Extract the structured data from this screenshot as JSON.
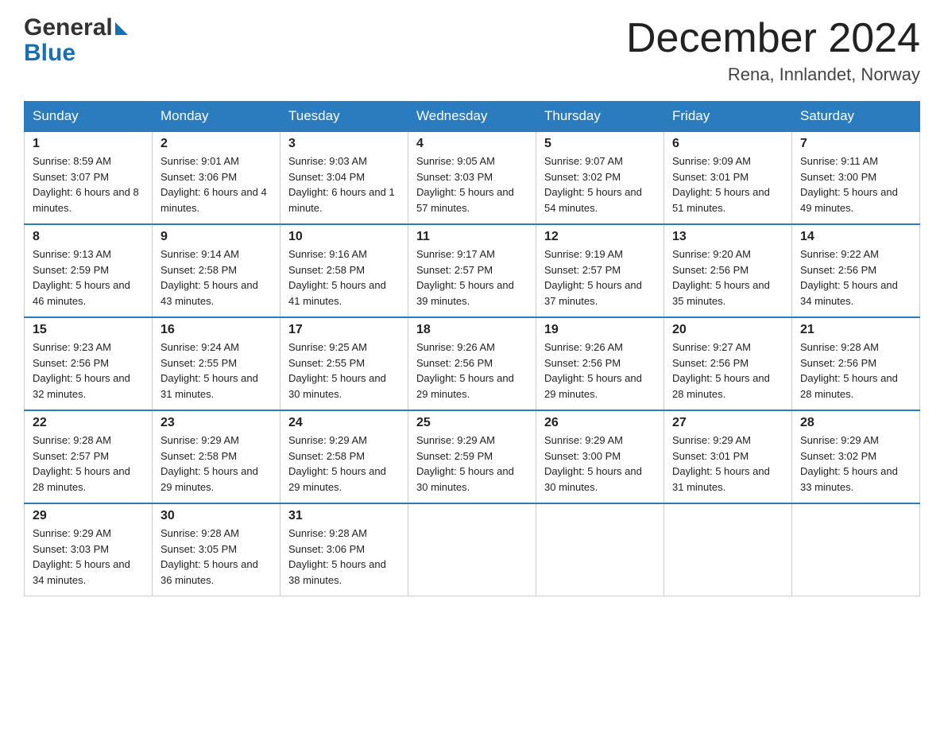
{
  "header": {
    "title": "December 2024",
    "location": "Rena, Innlandet, Norway",
    "logo_general": "General",
    "logo_blue": "Blue"
  },
  "days_of_week": [
    "Sunday",
    "Monday",
    "Tuesday",
    "Wednesday",
    "Thursday",
    "Friday",
    "Saturday"
  ],
  "weeks": [
    [
      {
        "day": "1",
        "sunrise": "Sunrise: 8:59 AM",
        "sunset": "Sunset: 3:07 PM",
        "daylight": "Daylight: 6 hours and 8 minutes."
      },
      {
        "day": "2",
        "sunrise": "Sunrise: 9:01 AM",
        "sunset": "Sunset: 3:06 PM",
        "daylight": "Daylight: 6 hours and 4 minutes."
      },
      {
        "day": "3",
        "sunrise": "Sunrise: 9:03 AM",
        "sunset": "Sunset: 3:04 PM",
        "daylight": "Daylight: 6 hours and 1 minute."
      },
      {
        "day": "4",
        "sunrise": "Sunrise: 9:05 AM",
        "sunset": "Sunset: 3:03 PM",
        "daylight": "Daylight: 5 hours and 57 minutes."
      },
      {
        "day": "5",
        "sunrise": "Sunrise: 9:07 AM",
        "sunset": "Sunset: 3:02 PM",
        "daylight": "Daylight: 5 hours and 54 minutes."
      },
      {
        "day": "6",
        "sunrise": "Sunrise: 9:09 AM",
        "sunset": "Sunset: 3:01 PM",
        "daylight": "Daylight: 5 hours and 51 minutes."
      },
      {
        "day": "7",
        "sunrise": "Sunrise: 9:11 AM",
        "sunset": "Sunset: 3:00 PM",
        "daylight": "Daylight: 5 hours and 49 minutes."
      }
    ],
    [
      {
        "day": "8",
        "sunrise": "Sunrise: 9:13 AM",
        "sunset": "Sunset: 2:59 PM",
        "daylight": "Daylight: 5 hours and 46 minutes."
      },
      {
        "day": "9",
        "sunrise": "Sunrise: 9:14 AM",
        "sunset": "Sunset: 2:58 PM",
        "daylight": "Daylight: 5 hours and 43 minutes."
      },
      {
        "day": "10",
        "sunrise": "Sunrise: 9:16 AM",
        "sunset": "Sunset: 2:58 PM",
        "daylight": "Daylight: 5 hours and 41 minutes."
      },
      {
        "day": "11",
        "sunrise": "Sunrise: 9:17 AM",
        "sunset": "Sunset: 2:57 PM",
        "daylight": "Daylight: 5 hours and 39 minutes."
      },
      {
        "day": "12",
        "sunrise": "Sunrise: 9:19 AM",
        "sunset": "Sunset: 2:57 PM",
        "daylight": "Daylight: 5 hours and 37 minutes."
      },
      {
        "day": "13",
        "sunrise": "Sunrise: 9:20 AM",
        "sunset": "Sunset: 2:56 PM",
        "daylight": "Daylight: 5 hours and 35 minutes."
      },
      {
        "day": "14",
        "sunrise": "Sunrise: 9:22 AM",
        "sunset": "Sunset: 2:56 PM",
        "daylight": "Daylight: 5 hours and 34 minutes."
      }
    ],
    [
      {
        "day": "15",
        "sunrise": "Sunrise: 9:23 AM",
        "sunset": "Sunset: 2:56 PM",
        "daylight": "Daylight: 5 hours and 32 minutes."
      },
      {
        "day": "16",
        "sunrise": "Sunrise: 9:24 AM",
        "sunset": "Sunset: 2:55 PM",
        "daylight": "Daylight: 5 hours and 31 minutes."
      },
      {
        "day": "17",
        "sunrise": "Sunrise: 9:25 AM",
        "sunset": "Sunset: 2:55 PM",
        "daylight": "Daylight: 5 hours and 30 minutes."
      },
      {
        "day": "18",
        "sunrise": "Sunrise: 9:26 AM",
        "sunset": "Sunset: 2:56 PM",
        "daylight": "Daylight: 5 hours and 29 minutes."
      },
      {
        "day": "19",
        "sunrise": "Sunrise: 9:26 AM",
        "sunset": "Sunset: 2:56 PM",
        "daylight": "Daylight: 5 hours and 29 minutes."
      },
      {
        "day": "20",
        "sunrise": "Sunrise: 9:27 AM",
        "sunset": "Sunset: 2:56 PM",
        "daylight": "Daylight: 5 hours and 28 minutes."
      },
      {
        "day": "21",
        "sunrise": "Sunrise: 9:28 AM",
        "sunset": "Sunset: 2:56 PM",
        "daylight": "Daylight: 5 hours and 28 minutes."
      }
    ],
    [
      {
        "day": "22",
        "sunrise": "Sunrise: 9:28 AM",
        "sunset": "Sunset: 2:57 PM",
        "daylight": "Daylight: 5 hours and 28 minutes."
      },
      {
        "day": "23",
        "sunrise": "Sunrise: 9:29 AM",
        "sunset": "Sunset: 2:58 PM",
        "daylight": "Daylight: 5 hours and 29 minutes."
      },
      {
        "day": "24",
        "sunrise": "Sunrise: 9:29 AM",
        "sunset": "Sunset: 2:58 PM",
        "daylight": "Daylight: 5 hours and 29 minutes."
      },
      {
        "day": "25",
        "sunrise": "Sunrise: 9:29 AM",
        "sunset": "Sunset: 2:59 PM",
        "daylight": "Daylight: 5 hours and 30 minutes."
      },
      {
        "day": "26",
        "sunrise": "Sunrise: 9:29 AM",
        "sunset": "Sunset: 3:00 PM",
        "daylight": "Daylight: 5 hours and 30 minutes."
      },
      {
        "day": "27",
        "sunrise": "Sunrise: 9:29 AM",
        "sunset": "Sunset: 3:01 PM",
        "daylight": "Daylight: 5 hours and 31 minutes."
      },
      {
        "day": "28",
        "sunrise": "Sunrise: 9:29 AM",
        "sunset": "Sunset: 3:02 PM",
        "daylight": "Daylight: 5 hours and 33 minutes."
      }
    ],
    [
      {
        "day": "29",
        "sunrise": "Sunrise: 9:29 AM",
        "sunset": "Sunset: 3:03 PM",
        "daylight": "Daylight: 5 hours and 34 minutes."
      },
      {
        "day": "30",
        "sunrise": "Sunrise: 9:28 AM",
        "sunset": "Sunset: 3:05 PM",
        "daylight": "Daylight: 5 hours and 36 minutes."
      },
      {
        "day": "31",
        "sunrise": "Sunrise: 9:28 AM",
        "sunset": "Sunset: 3:06 PM",
        "daylight": "Daylight: 5 hours and 38 minutes."
      },
      null,
      null,
      null,
      null
    ]
  ]
}
